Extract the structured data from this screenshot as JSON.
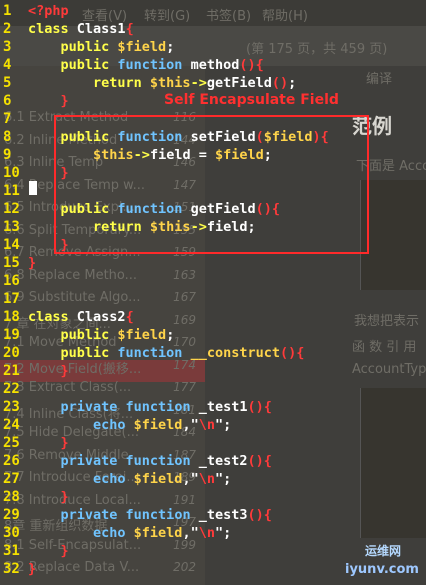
{
  "background": {
    "menu": [
      "查看(V)",
      "转到(G)",
      "书签(B)",
      "帮助(H)"
    ],
    "page_status": "(第 175 页，共 459 页)",
    "toc_items": [
      {
        "label": "6.1 Extract Method",
        "page": "116"
      },
      {
        "label": "6.2 Inline Method",
        "page": "144"
      },
      {
        "label": "6.3 Inline Temp",
        "page": "146"
      },
      {
        "label": "6.4 Replace Temp w...",
        "page": "147"
      },
      {
        "label": "6.5 Introduce Expl...",
        "page": "151"
      },
      {
        "label": "6.6 Split Temporary...",
        "page": "155"
      },
      {
        "label": "6.7 Remove Assign...",
        "page": "159"
      },
      {
        "label": "6.8 Replace Metho...",
        "page": "163"
      },
      {
        "label": "6.9 Substitute Algo...",
        "page": "167"
      },
      {
        "label": "7 章 在对象之间...",
        "page": "169"
      },
      {
        "label": "7.1 Move Method",
        "page": "170"
      },
      {
        "label": "7.2 Move Field(搬移...",
        "page": "174"
      },
      {
        "label": "7.3 Extract Class(...",
        "page": "177"
      },
      {
        "label": "7.4 Inline Class(将...",
        "page": "181"
      },
      {
        "label": "7.5 Hide Delegate(...",
        "page": "184"
      },
      {
        "label": "7.6 Remove Middle...",
        "page": "187"
      },
      {
        "label": "7.7 Introduce Forei...",
        "page": "189"
      },
      {
        "label": "7.8 Introduce Local...",
        "page": "191"
      },
      {
        "label": "8章 重新组织数据",
        "page": "197"
      },
      {
        "label": "8.1 Self-Encapsulat...",
        "page": "199"
      },
      {
        "label": "8.2 Replace Data V...",
        "page": "202"
      }
    ],
    "heading": "范例",
    "right_texts": [
      "编译",
      "下面是 Acco",
      "我想把表示",
      "函 数 引 用",
      "AccountTyp"
    ]
  },
  "annotation": "Self Encapsulate Field",
  "watermark": {
    "line1": "运维网",
    "line2": "iyunv.com"
  },
  "code": [
    {
      "n": "1",
      "tokens": [
        {
          "t": "<?php",
          "c": "red"
        }
      ]
    },
    {
      "n": "2",
      "tokens": [
        {
          "t": "class ",
          "c": "kw"
        },
        {
          "t": "Class1",
          "c": "op"
        },
        {
          "t": "{",
          "c": "red"
        }
      ]
    },
    {
      "n": "3",
      "tokens": [
        {
          "t": "    public ",
          "c": "kw"
        },
        {
          "t": "$field",
          "c": "var"
        },
        {
          "t": ";",
          "c": "op"
        }
      ]
    },
    {
      "n": "4",
      "tokens": [
        {
          "t": "    public ",
          "c": "kw"
        },
        {
          "t": "function ",
          "c": "fn"
        },
        {
          "t": "method",
          "c": "op"
        },
        {
          "t": "(){",
          "c": "red"
        }
      ]
    },
    {
      "n": "5",
      "tokens": [
        {
          "t": "        return ",
          "c": "kw"
        },
        {
          "t": "$this",
          "c": "var"
        },
        {
          "t": "->",
          "c": "kw"
        },
        {
          "t": "getField",
          "c": "op"
        },
        {
          "t": "()",
          "c": "red"
        },
        {
          "t": ";",
          "c": "op"
        }
      ]
    },
    {
      "n": "6",
      "tokens": [
        {
          "t": "    }",
          "c": "red"
        }
      ]
    },
    {
      "n": "7",
      "tokens": []
    },
    {
      "n": "8",
      "tokens": [
        {
          "t": "    public ",
          "c": "kw"
        },
        {
          "t": "function ",
          "c": "fn"
        },
        {
          "t": "setField",
          "c": "op"
        },
        {
          "t": "(",
          "c": "red"
        },
        {
          "t": "$field",
          "c": "var"
        },
        {
          "t": "){",
          "c": "red"
        }
      ]
    },
    {
      "n": "9",
      "tokens": [
        {
          "t": "        $this",
          "c": "var"
        },
        {
          "t": "->",
          "c": "kw"
        },
        {
          "t": "field = ",
          "c": "op"
        },
        {
          "t": "$field",
          "c": "var"
        },
        {
          "t": ";",
          "c": "op"
        }
      ]
    },
    {
      "n": "10",
      "tokens": [
        {
          "t": "    }",
          "c": "red"
        }
      ]
    },
    {
      "n": "11",
      "tokens": []
    },
    {
      "n": "12",
      "tokens": [
        {
          "t": "    public ",
          "c": "kw"
        },
        {
          "t": "function ",
          "c": "fn"
        },
        {
          "t": "getField",
          "c": "op"
        },
        {
          "t": "(){",
          "c": "red"
        }
      ]
    },
    {
      "n": "13",
      "tokens": [
        {
          "t": "        return ",
          "c": "kw"
        },
        {
          "t": "$this",
          "c": "var"
        },
        {
          "t": "->",
          "c": "kw"
        },
        {
          "t": "field;",
          "c": "op"
        }
      ]
    },
    {
      "n": "14",
      "tokens": [
        {
          "t": "    }",
          "c": "red"
        }
      ]
    },
    {
      "n": "15",
      "tokens": [
        {
          "t": "}",
          "c": "red"
        }
      ]
    },
    {
      "n": "16",
      "tokens": []
    },
    {
      "n": "17",
      "tokens": []
    },
    {
      "n": "18",
      "tokens": [
        {
          "t": "class ",
          "c": "kw"
        },
        {
          "t": "Class2",
          "c": "op"
        },
        {
          "t": "{",
          "c": "red"
        }
      ]
    },
    {
      "n": "19",
      "tokens": [
        {
          "t": "    public ",
          "c": "kw"
        },
        {
          "t": "$field",
          "c": "var"
        },
        {
          "t": ";",
          "c": "op"
        }
      ]
    },
    {
      "n": "20",
      "tokens": [
        {
          "t": "    public ",
          "c": "kw"
        },
        {
          "t": "function ",
          "c": "fn"
        },
        {
          "t": "__construct",
          "c": "var"
        },
        {
          "t": "(){",
          "c": "red"
        }
      ]
    },
    {
      "n": "21",
      "tokens": [
        {
          "t": "    }",
          "c": "red"
        }
      ]
    },
    {
      "n": "22",
      "tokens": []
    },
    {
      "n": "23",
      "tokens": [
        {
          "t": "    private ",
          "c": "fn"
        },
        {
          "t": "function ",
          "c": "fn"
        },
        {
          "t": "_test1",
          "c": "op"
        },
        {
          "t": "(){",
          "c": "red"
        }
      ]
    },
    {
      "n": "24",
      "tokens": [
        {
          "t": "        echo ",
          "c": "fn"
        },
        {
          "t": "$field",
          "c": "var"
        },
        {
          "t": ",\"",
          "c": "op"
        },
        {
          "t": "\\n",
          "c": "red"
        },
        {
          "t": "\";",
          "c": "op"
        }
      ]
    },
    {
      "n": "25",
      "tokens": [
        {
          "t": "    }",
          "c": "red"
        }
      ]
    },
    {
      "n": "26",
      "tokens": [
        {
          "t": "    private ",
          "c": "fn"
        },
        {
          "t": "function ",
          "c": "fn"
        },
        {
          "t": "_test2",
          "c": "op"
        },
        {
          "t": "(){",
          "c": "red"
        }
      ]
    },
    {
      "n": "27",
      "tokens": [
        {
          "t": "        echo ",
          "c": "fn"
        },
        {
          "t": "$field",
          "c": "var"
        },
        {
          "t": ",\"",
          "c": "op"
        },
        {
          "t": "\\n",
          "c": "red"
        },
        {
          "t": "\";",
          "c": "op"
        }
      ]
    },
    {
      "n": "28",
      "tokens": [
        {
          "t": "    }",
          "c": "red"
        }
      ]
    },
    {
      "n": "29",
      "tokens": [
        {
          "t": "    private ",
          "c": "fn"
        },
        {
          "t": "function ",
          "c": "fn"
        },
        {
          "t": "_test3",
          "c": "op"
        },
        {
          "t": "(){",
          "c": "red"
        }
      ]
    },
    {
      "n": "30",
      "tokens": [
        {
          "t": "        echo ",
          "c": "fn"
        },
        {
          "t": "$field",
          "c": "var"
        },
        {
          "t": ",\"",
          "c": "op"
        },
        {
          "t": "\\n",
          "c": "red"
        },
        {
          "t": "\";",
          "c": "op"
        }
      ]
    },
    {
      "n": "31",
      "tokens": [
        {
          "t": "    }",
          "c": "red"
        }
      ]
    },
    {
      "n": "32",
      "tokens": [
        {
          "t": "}",
          "c": "red"
        }
      ]
    }
  ]
}
